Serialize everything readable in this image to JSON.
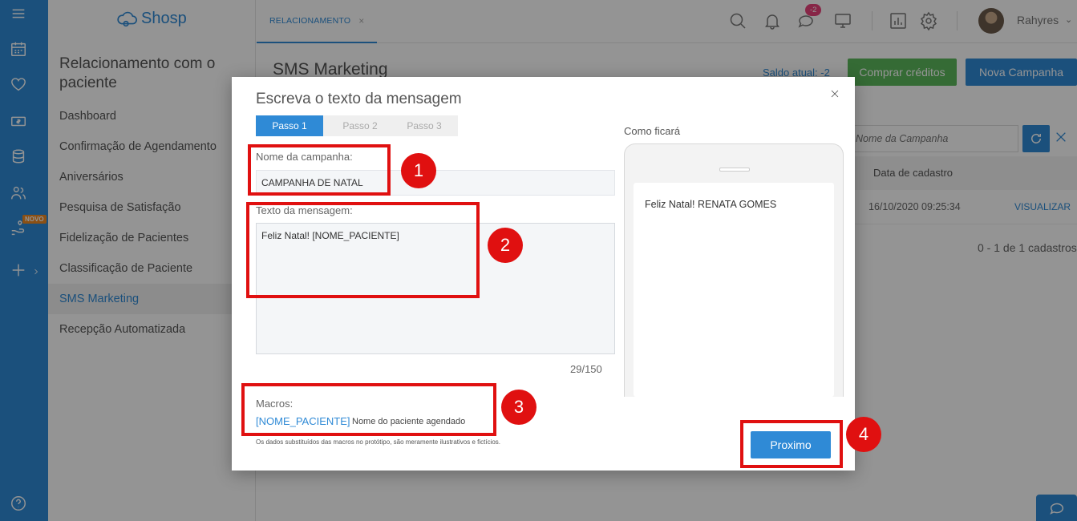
{
  "app": {
    "logo_text": "Shosp"
  },
  "rail": {
    "novo_badge": "NOVO",
    "icons": [
      "menu-icon",
      "calendar-icon",
      "heart-icon",
      "money-icon",
      "database-icon",
      "people-icon",
      "hand-heart-icon",
      "plus-icon",
      "help-icon"
    ]
  },
  "sidebar": {
    "title": "Relacionamento com o paciente",
    "items": [
      {
        "label": "Dashboard",
        "active": false
      },
      {
        "label": "Confirmação de Agendamento",
        "active": false
      },
      {
        "label": "Aniversários",
        "active": false
      },
      {
        "label": "Pesquisa de Satisfação",
        "active": false
      },
      {
        "label": "Fidelização de Pacientes",
        "active": false
      },
      {
        "label": "Classificação de Paciente",
        "active": false
      },
      {
        "label": "SMS Marketing",
        "active": true
      },
      {
        "label": "Recepção Automatizada",
        "active": false
      }
    ]
  },
  "topbar": {
    "tab_label": "RELACIONAMENTO",
    "tab_close": "×",
    "chat_badge": "-2",
    "username": "Rahyres",
    "chevron": "⌄"
  },
  "main": {
    "page_title": "SMS Marketing",
    "saldo": "Saldo atual: -2",
    "buy_button": "Comprar créditos",
    "new_campaign_button": "Nova Campanha",
    "search_placeholder": "Nome da Campanha",
    "table_header_date": "Data de cadastro",
    "row_date": "16/10/2020 09:25:34",
    "row_action": "VISUALIZAR",
    "count_text": "0 - 1 de 1 cadastros"
  },
  "modal": {
    "title": "Escreva o texto da mensagem",
    "steps": [
      "Passo 1",
      "Passo 2",
      "Passo 3"
    ],
    "active_step": 0,
    "name_label": "Nome da campanha:",
    "name_value": "CAMPANHA DE NATAL",
    "text_label": "Texto da mensagem:",
    "text_value": "Feliz Natal! [NOME_PACIENTE]",
    "char_count": "29/150",
    "macros_label": "Macros:",
    "macro_key": "[NOME_PACIENTE]",
    "macro_desc": "Nome do paciente agendado",
    "disclaimer": "Os dados substituídos das macros no protótipo, são meramente ilustrativos e fictícios.",
    "preview_label": "Como ficará",
    "preview_message": "Feliz Natal! RENATA GOMES",
    "next_button": "Proximo"
  },
  "annotations": {
    "labels": [
      "1",
      "2",
      "3",
      "4"
    ],
    "color": "#e01010"
  },
  "colors": {
    "primary": "#2f8ad6",
    "success": "#5cb85c",
    "badge": "#e9427a",
    "novo": "#f08a24"
  }
}
